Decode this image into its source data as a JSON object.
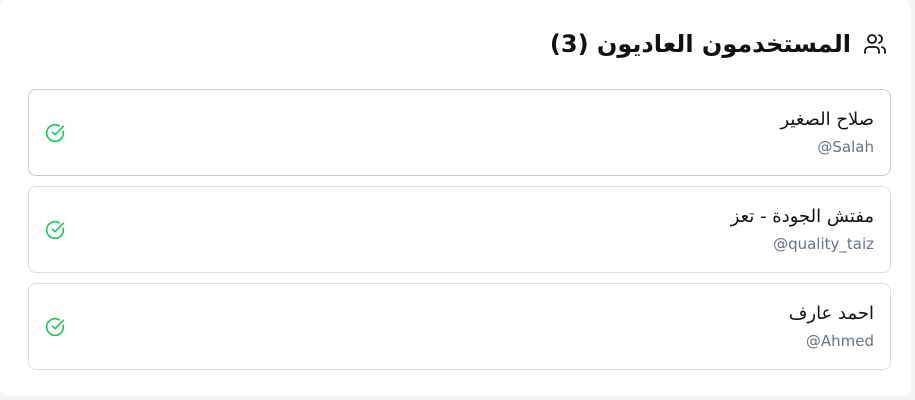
{
  "section": {
    "title": "المستخدمون العاديون (3)",
    "icon": "users-icon"
  },
  "users": [
    {
      "name": "صلاح الصغير",
      "handle": "@Salah",
      "status_icon": "check-circle-icon"
    },
    {
      "name": "مفتش الجودة - تعز",
      "handle": "@quality_taiz",
      "status_icon": "check-circle-icon"
    },
    {
      "name": "احمد عارف",
      "handle": "@Ahmed",
      "status_icon": "check-circle-icon"
    }
  ],
  "colors": {
    "check": "#22c55e",
    "border": "#dcdde1",
    "muted_text": "#6b7280"
  }
}
